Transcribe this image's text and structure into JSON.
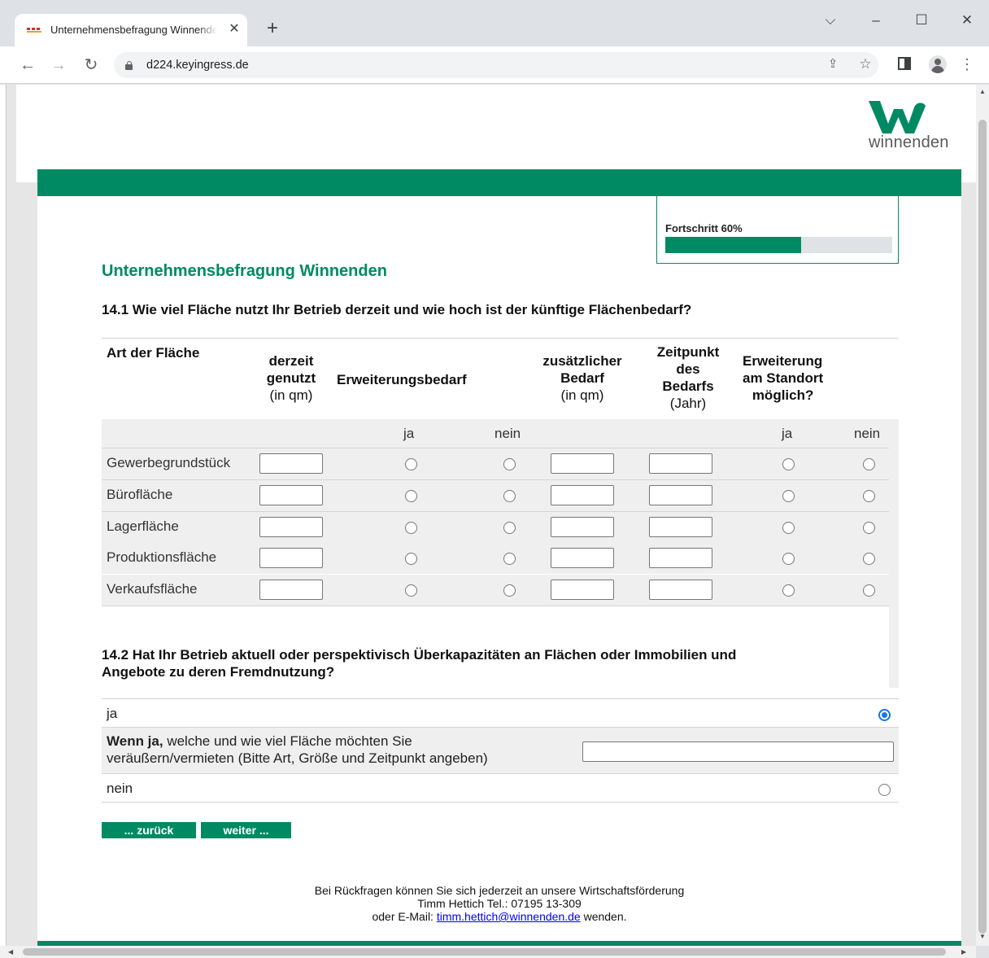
{
  "browser": {
    "tab_title": "Unternehmensbefragung Winnenden",
    "new_tab_icon": "plus-icon",
    "url": "d224.keyingress.de"
  },
  "site": {
    "logo_text": "winnenden",
    "brand_color": "#008a63"
  },
  "progress": {
    "label": "Fortschritt 60%",
    "value": 0.6
  },
  "survey_title": "Unternehmensbefragung Winnenden",
  "q141": {
    "title": "14.1 Wie viel Fläche nutzt Ihr Betrieb derzeit und wie hoch ist der künftige Flächenbedarf?",
    "headers": {
      "art": "Art der Fläche",
      "derzeit_line1": "derzeit",
      "derzeit_line2": "genutzt",
      "derzeit_unit": "(in qm)",
      "erweiterungsbedarf": "Erweiterungsbedarf",
      "zusatz_line1": "zusätzlicher",
      "zusatz_line2": "Bedarf",
      "zusatz_unit": "(in qm)",
      "zeit_line1": "Zeitpunkt",
      "zeit_line2": "des",
      "zeit_line3": "Bedarfs",
      "zeit_unit": "(Jahr)",
      "standort_line1": "Erweiterung",
      "standort_line2": "am Standort",
      "standort_line3": "möglich?"
    },
    "sub": {
      "ja": "ja",
      "nein": "nein"
    },
    "rows": [
      {
        "label": "Gewerbegrundstück"
      },
      {
        "label": "Bürofläche"
      },
      {
        "label": "Lagerfläche"
      },
      {
        "label": "Produktionsfläche"
      },
      {
        "label": "Verkaufsfläche"
      }
    ]
  },
  "q142": {
    "title_line1": "14.2 Hat Ihr Betrieb aktuell oder perspektivisch Überkapazitäten an Flächen oder Immobilien und",
    "title_line2": "Angebote zu deren Fremdnutzung?",
    "options": {
      "ja": "ja",
      "nein": "nein",
      "selected": "ja"
    },
    "conditional_bold": "Wenn ja,",
    "conditional_text1": " welche und wie viel Fläche möchten Sie",
    "conditional_text2": "veräußern/vermieten (Bitte Art, Größe und Zeitpunkt angeben)",
    "conditional_value": ""
  },
  "buttons": {
    "back": "... zurück",
    "next": "weiter ..."
  },
  "footer": {
    "line1": "Bei Rückfragen können Sie sich jederzeit an unsere Wirtschaftsförderung",
    "line2": "Timm Hettich Tel.: 07195 13-309",
    "line3_pre": "oder E-Mail: ",
    "email": "timm.hettich@winnenden.de",
    "line3_post": " wenden."
  }
}
